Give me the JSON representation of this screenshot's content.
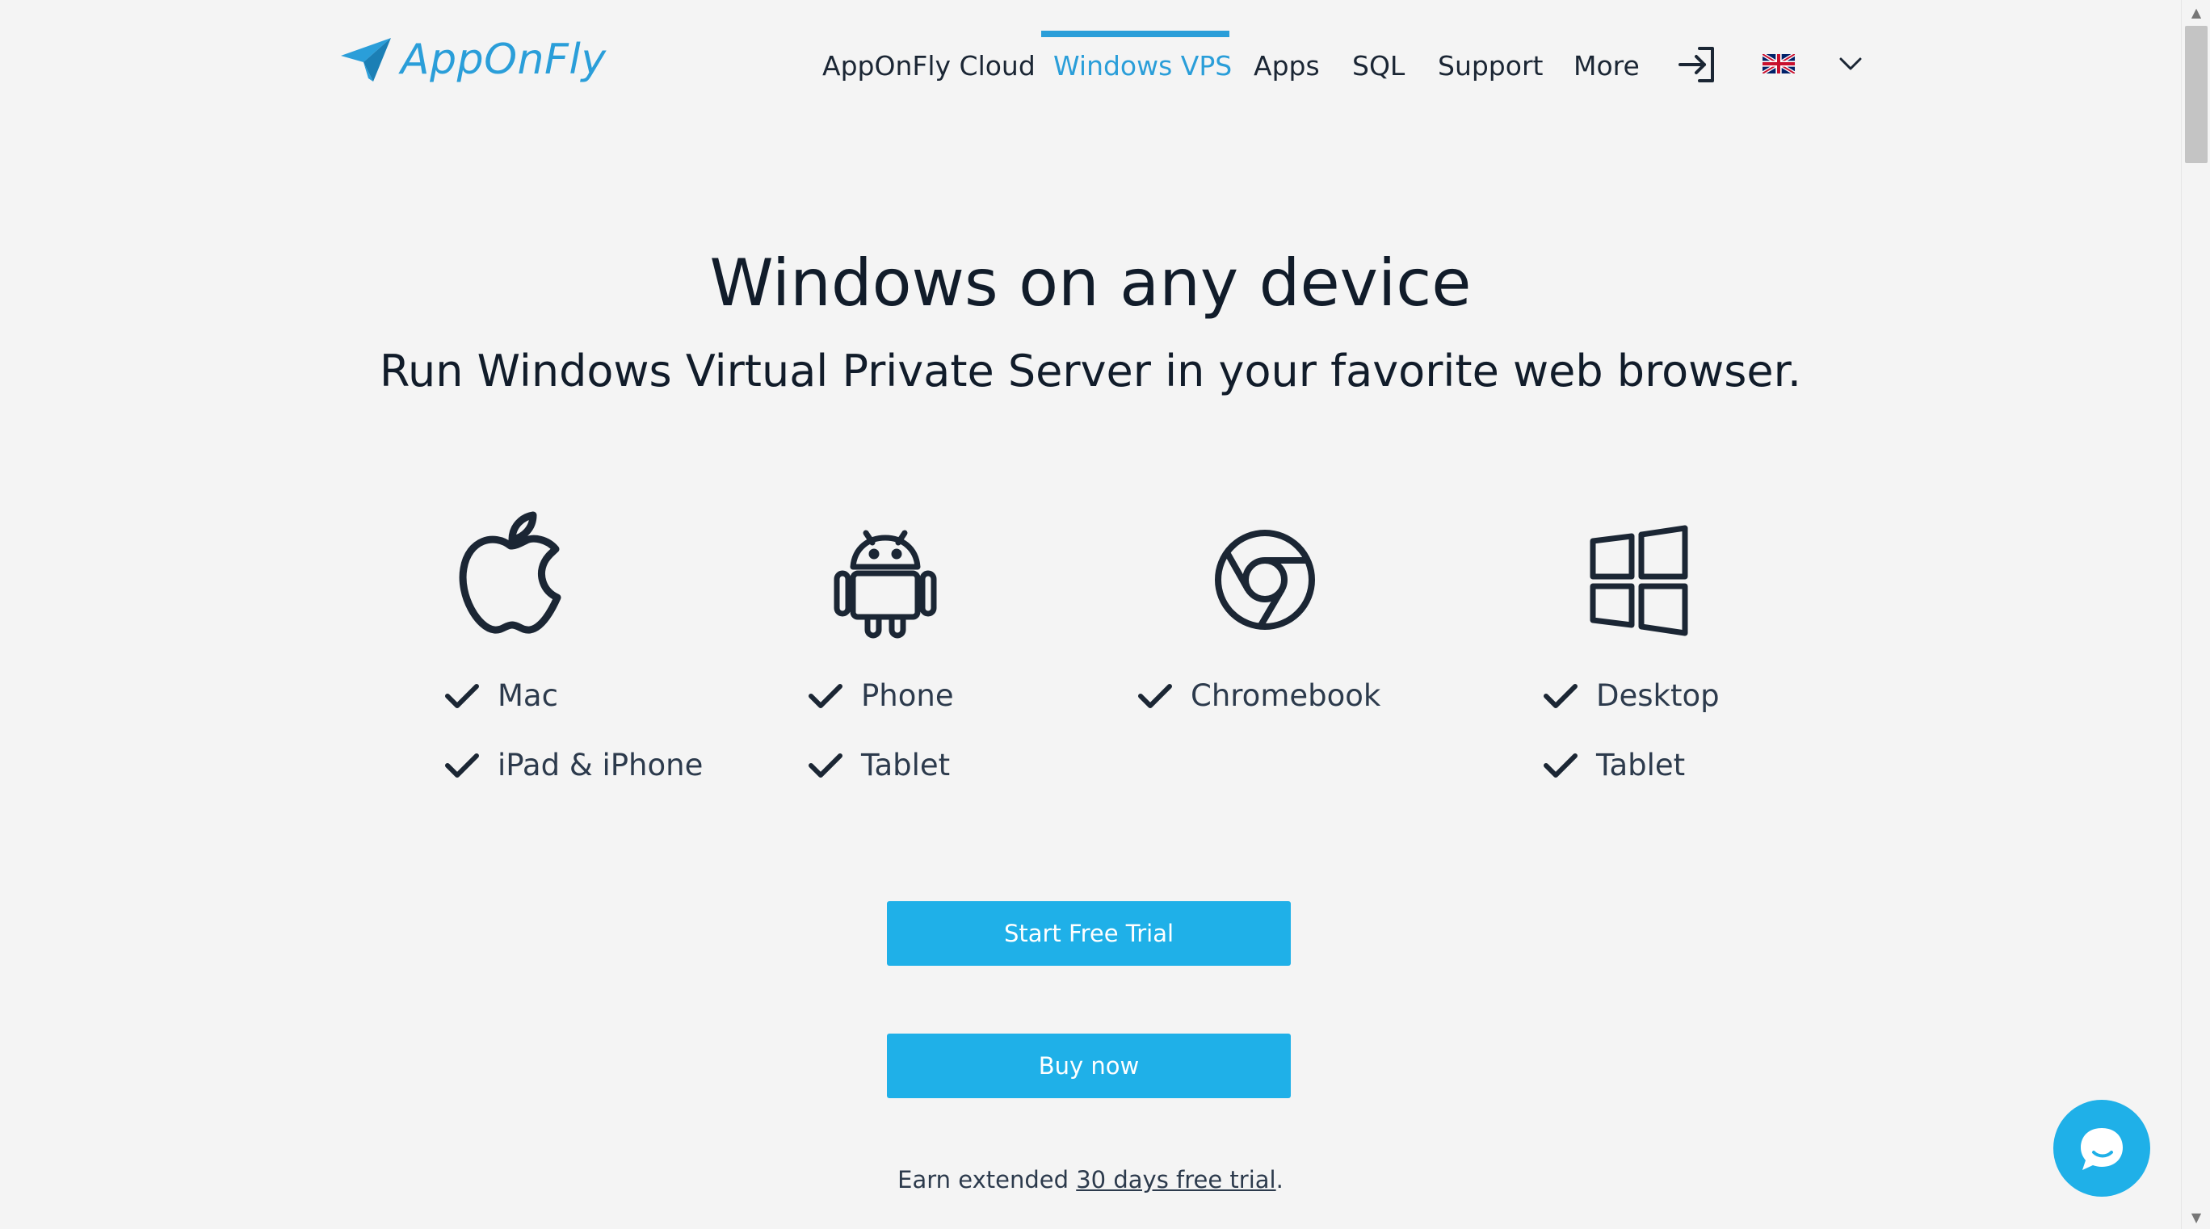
{
  "header": {
    "logo_text": "AppOnFly",
    "nav": [
      {
        "label": "AppOnFly Cloud",
        "active": false
      },
      {
        "label": "Windows VPS",
        "active": true
      },
      {
        "label": "Apps",
        "active": false
      },
      {
        "label": "SQL",
        "active": false
      },
      {
        "label": "Support",
        "active": false
      },
      {
        "label": "More",
        "active": false
      }
    ],
    "icons": [
      "login-icon",
      "uk-flag-icon",
      "chevron-down-icon"
    ]
  },
  "hero": {
    "title": "Windows on any device",
    "subtitle": "Run Windows Virtual Private Server in your favorite web browser."
  },
  "platforms": [
    {
      "icon": "apple-icon",
      "features": [
        "Mac",
        "iPad & iPhone"
      ]
    },
    {
      "icon": "android-icon",
      "features": [
        "Phone",
        "Tablet"
      ]
    },
    {
      "icon": "chrome-icon",
      "features": [
        "Chromebook"
      ]
    },
    {
      "icon": "windows-icon",
      "features": [
        "Desktop",
        "Tablet"
      ]
    }
  ],
  "buttons": {
    "trial": "Start Free Trial",
    "buy": "Buy now"
  },
  "earn": {
    "prefix": "Earn extended ",
    "link": "30 days free trial",
    "suffix": "."
  },
  "colors": {
    "accent": "#2a9ed9",
    "button": "#1fb0e8",
    "background": "#f4f4f4",
    "text": "#1b2634"
  }
}
